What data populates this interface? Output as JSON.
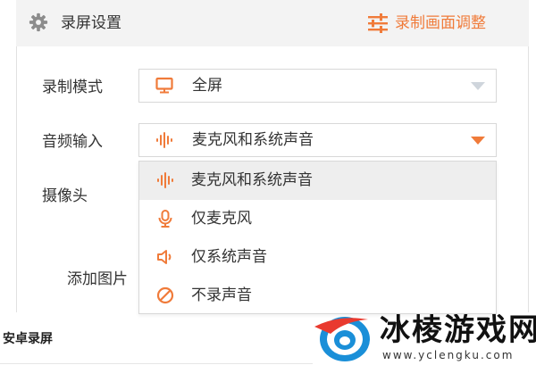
{
  "header": {
    "title": "录屏设置",
    "settings_icon": "gear-icon",
    "adjust_icon": "sliders-icon",
    "adjust_label": "录制画面调整"
  },
  "form": {
    "mode": {
      "label": "录制模式",
      "value": "全屏",
      "icon": "monitor-icon"
    },
    "audio": {
      "label": "音频输入",
      "value": "麦克风和系统声音",
      "icon": "soundwave-icon"
    },
    "camera": {
      "label": "摄像头"
    },
    "image": {
      "label": "添加图片"
    }
  },
  "audio_options": [
    {
      "label": "麦克风和系统声音",
      "icon": "soundwave-icon",
      "highlighted": true
    },
    {
      "label": "仅麦克风",
      "icon": "microphone-icon",
      "highlighted": false
    },
    {
      "label": "仅系统声音",
      "icon": "speaker-icon",
      "highlighted": false
    },
    {
      "label": "不录声音",
      "icon": "mute-icon",
      "highlighted": false
    }
  ],
  "footer": {
    "title": "安卓录屏"
  },
  "watermark": {
    "title": "冰棱游戏网",
    "url": "www.yclengku.com"
  },
  "colors": {
    "accent": "#f07b3a",
    "header_bg": "#f3f3f3",
    "border": "#d8d8d8",
    "highlight": "#eeeeee"
  }
}
